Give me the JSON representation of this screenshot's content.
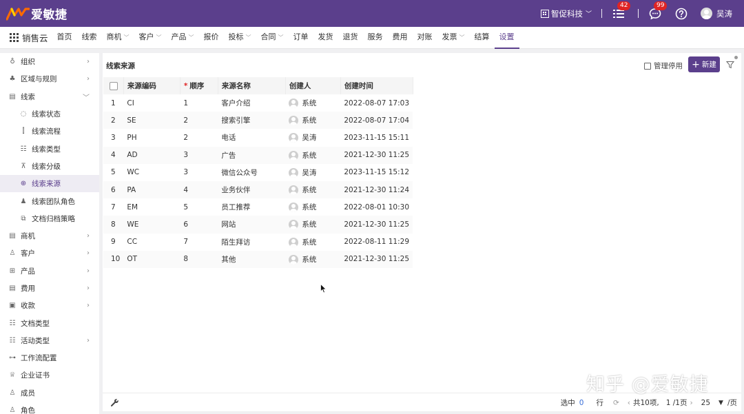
{
  "brand": {
    "name": "爱敏捷"
  },
  "topbar": {
    "company": "智促科技",
    "tasks_badge": "42",
    "messages_badge": "99",
    "user_name": "吴涛"
  },
  "nav": {
    "app_name": "销售云",
    "items": [
      {
        "label": "首页",
        "dropdown": false
      },
      {
        "label": "线索",
        "dropdown": false
      },
      {
        "label": "商机",
        "dropdown": true
      },
      {
        "label": "客户",
        "dropdown": true
      },
      {
        "label": "产品",
        "dropdown": true
      },
      {
        "label": "报价",
        "dropdown": false
      },
      {
        "label": "投标",
        "dropdown": true
      },
      {
        "label": "合同",
        "dropdown": true
      },
      {
        "label": "订单",
        "dropdown": false
      },
      {
        "label": "发货",
        "dropdown": false
      },
      {
        "label": "退货",
        "dropdown": false
      },
      {
        "label": "服务",
        "dropdown": false
      },
      {
        "label": "费用",
        "dropdown": false
      },
      {
        "label": "对账",
        "dropdown": false
      },
      {
        "label": "发票",
        "dropdown": true
      },
      {
        "label": "结算",
        "dropdown": false
      },
      {
        "label": "设置",
        "dropdown": false,
        "active": true
      }
    ]
  },
  "sidebar": {
    "items": [
      {
        "label": "组织",
        "icon": "org-icon",
        "glyph": "♁",
        "arrow": "right"
      },
      {
        "label": "区域与规则",
        "icon": "region-icon",
        "glyph": "♣",
        "arrow": "right"
      },
      {
        "label": "线索",
        "icon": "clue-icon",
        "glyph": "▤",
        "arrow": "down"
      },
      {
        "label": "线索状态",
        "icon": "status-icon",
        "glyph": "◌",
        "sub": true
      },
      {
        "label": "线索流程",
        "icon": "flow-icon",
        "glyph": "⫿",
        "sub": true
      },
      {
        "label": "线索类型",
        "icon": "type-icon",
        "glyph": "☷",
        "sub": true
      },
      {
        "label": "线索分级",
        "icon": "level-icon",
        "glyph": "⊼",
        "sub": true
      },
      {
        "label": "线索来源",
        "icon": "source-icon",
        "glyph": "⊕",
        "sub": true,
        "selected": true
      },
      {
        "label": "线索团队角色",
        "icon": "team-icon",
        "glyph": "♟",
        "sub": true
      },
      {
        "label": "文档归档策略",
        "icon": "archive-icon",
        "glyph": "⧉",
        "sub": true
      },
      {
        "label": "商机",
        "icon": "opportunity-icon",
        "glyph": "▤",
        "arrow": "right"
      },
      {
        "label": "客户",
        "icon": "customer-icon",
        "glyph": "♙",
        "arrow": "right"
      },
      {
        "label": "产品",
        "icon": "product-icon",
        "glyph": "⊞",
        "arrow": "right"
      },
      {
        "label": "费用",
        "icon": "expense-icon",
        "glyph": "▤",
        "arrow": "right"
      },
      {
        "label": "收款",
        "icon": "receipt-icon",
        "glyph": "▣",
        "arrow": "right"
      },
      {
        "label": "文档类型",
        "icon": "doc-type-icon",
        "glyph": "☷"
      },
      {
        "label": "活动类型",
        "icon": "activity-type-icon",
        "glyph": "☷",
        "arrow": "right"
      },
      {
        "label": "工作流配置",
        "icon": "workflow-icon",
        "glyph": "⊶"
      },
      {
        "label": "企业证书",
        "icon": "certificate-icon",
        "glyph": "♕"
      },
      {
        "label": "成员",
        "icon": "member-icon",
        "glyph": "♙"
      },
      {
        "label": "角色",
        "icon": "role-icon",
        "glyph": "♙"
      }
    ]
  },
  "panel": {
    "title": "线索来源",
    "manage_disabled": "管理停用",
    "new_button": "新建"
  },
  "table": {
    "columns": [
      "来源编码",
      "顺序",
      "来源名称",
      "创建人",
      "创建时间"
    ],
    "required_marker": "*",
    "rows": [
      {
        "n": "1",
        "code": "CI",
        "order": "1",
        "name": "客户介绍",
        "creator": "系统",
        "created": "2022-08-07 17:03"
      },
      {
        "n": "2",
        "code": "SE",
        "order": "2",
        "name": "搜索引擎",
        "creator": "系统",
        "created": "2022-08-07 17:04"
      },
      {
        "n": "3",
        "code": "PH",
        "order": "2",
        "name": "电话",
        "creator": "吴涛",
        "created": "2023-11-15 15:11"
      },
      {
        "n": "4",
        "code": "AD",
        "order": "3",
        "name": "广告",
        "creator": "系统",
        "created": "2021-12-30 11:25"
      },
      {
        "n": "5",
        "code": "WC",
        "order": "3",
        "name": "微信公众号",
        "creator": "吴涛",
        "created": "2023-11-15 15:12"
      },
      {
        "n": "6",
        "code": "PA",
        "order": "4",
        "name": "业务伙伴",
        "creator": "系统",
        "created": "2021-12-30 11:24"
      },
      {
        "n": "7",
        "code": "EM",
        "order": "5",
        "name": "员工推荐",
        "creator": "系统",
        "created": "2022-08-01 10:30"
      },
      {
        "n": "8",
        "code": "WE",
        "order": "6",
        "name": "网站",
        "creator": "系统",
        "created": "2021-12-30 11:25"
      },
      {
        "n": "9",
        "code": "CC",
        "order": "7",
        "name": "陌生拜访",
        "creator": "系统",
        "created": "2022-08-11 11:29"
      },
      {
        "n": "10",
        "code": "OT",
        "order": "8",
        "name": "其他",
        "creator": "系统",
        "created": "2021-12-30 11:25"
      }
    ]
  },
  "footer": {
    "selected_label": "选中",
    "selected_count": "0",
    "rows_label": "行",
    "total": "共10项,",
    "page": "1 /1页",
    "page_size": "25",
    "per_page": "/页"
  },
  "watermark": "知乎 @爱敏捷",
  "colors": {
    "brand": "#5b3f8c",
    "badge": "#e02424",
    "link": "#5b3fc4"
  }
}
